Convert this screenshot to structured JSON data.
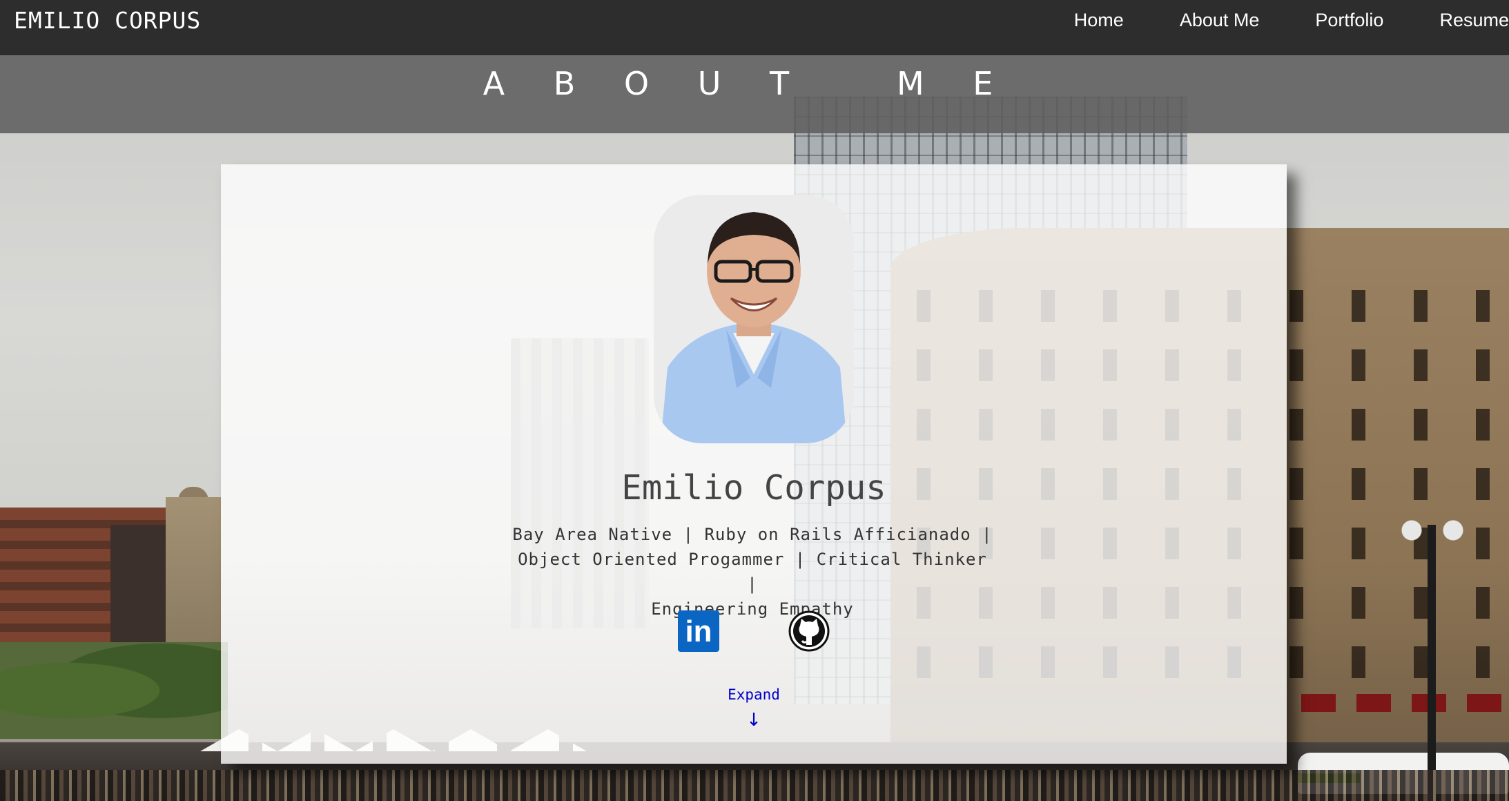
{
  "navbar": {
    "brand": "EMILIO CORPUS",
    "links": [
      "Home",
      "About Me",
      "Portfolio",
      "Resume"
    ]
  },
  "banner": {
    "title": "A B O U T   M E"
  },
  "profile": {
    "name": "Emilio Corpus",
    "tagline_lines": [
      "Bay Area Native | Ruby on Rails Afficianado |",
      "Object Oriented Progammer | Critical Thinker |",
      "Engineering Empathy"
    ],
    "linkedin_glyph": "in",
    "expand_label": "Expand",
    "expand_arrow": "↓"
  },
  "icons": {
    "linkedin": "linkedin-icon",
    "github": "github-icon"
  },
  "colors": {
    "navbar_bg": "#2d2d2d",
    "banner_bg": "#5f5f5f",
    "link_blue": "#0000cc",
    "linkedin_blue": "#0a66c2"
  }
}
